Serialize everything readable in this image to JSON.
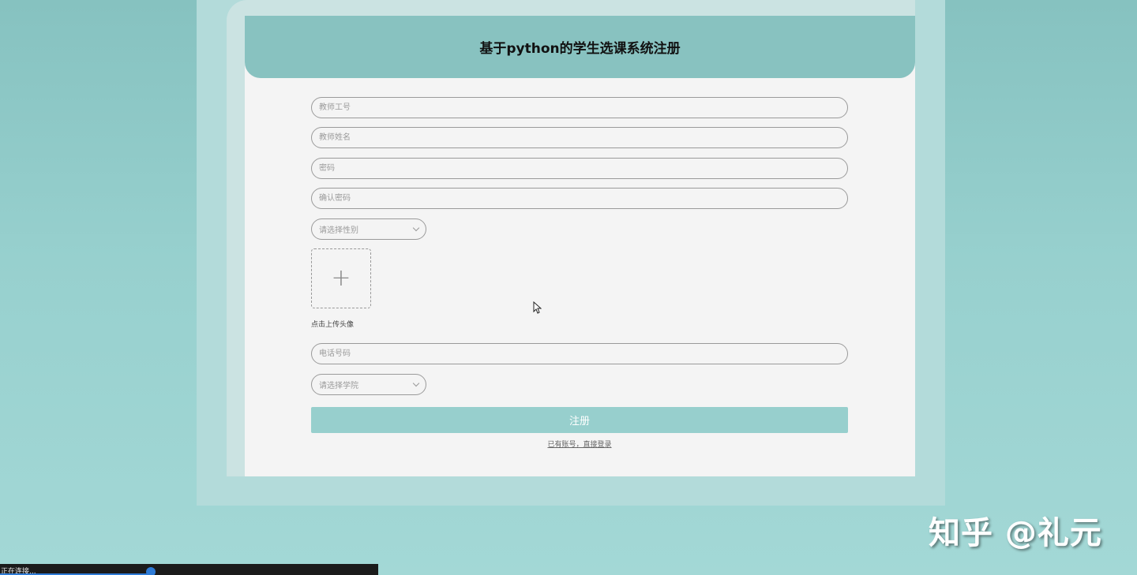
{
  "header": {
    "title": "基于python的学生选课系统注册"
  },
  "form": {
    "teacher_id_placeholder": "教师工号",
    "teacher_name_placeholder": "教师姓名",
    "password_placeholder": "密码",
    "confirm_password_placeholder": "确认密码",
    "gender_select": "请选择性别",
    "avatar_upload_label": "点击上传头像",
    "phone_placeholder": "电话号码",
    "college_select": "请选择学院",
    "register_button": "注册",
    "login_link": "已有账号，直接登录"
  },
  "watermark": "知乎 @礼元",
  "taskbar": {
    "status_text": "正在连接..."
  },
  "colors": {
    "header": "#88c2c0",
    "button": "#97cfcd",
    "card": "#f4f4f4",
    "background": "#97d0ce"
  }
}
